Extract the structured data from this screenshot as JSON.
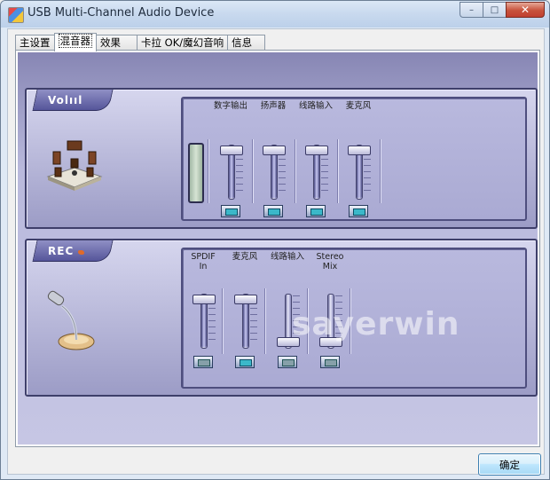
{
  "window": {
    "title": "USB Multi-Channel Audio Device",
    "min_glyph": "–",
    "max_glyph": "□",
    "close_glyph": "✕"
  },
  "tabs": [
    {
      "label": "主设置",
      "active": false
    },
    {
      "label": "混音器",
      "active": true
    },
    {
      "label": "效果",
      "active": false
    },
    {
      "label": "卡拉 OK/魔幻音响",
      "active": false
    },
    {
      "label": "信息",
      "active": false
    }
  ],
  "volume_section": {
    "badge": "Volııl",
    "channels": [
      {
        "label": "数字输出",
        "level": 0.95,
        "button_state": "on"
      },
      {
        "label": "扬声器",
        "level": 0.95,
        "button_state": "on"
      },
      {
        "label": "线路输入",
        "level": 0.95,
        "button_state": "on"
      },
      {
        "label": "麦克风",
        "level": 0.95,
        "button_state": "on"
      }
    ]
  },
  "record_section": {
    "badge": "REC",
    "channels": [
      {
        "label": "SPDIF",
        "sublabel": "In",
        "level": 0.95,
        "button_state": "off"
      },
      {
        "label": "麦克风",
        "sublabel": "",
        "level": 0.95,
        "button_state": "on"
      },
      {
        "label": "线路输入",
        "sublabel": "",
        "level": 0.05,
        "button_state": "off"
      },
      {
        "label": "Stereo",
        "sublabel": "Mix",
        "level": 0.05,
        "button_state": "off"
      }
    ]
  },
  "watermark": "sayerwin",
  "ok_button": "确定",
  "colors": {
    "panel_accent": "#55559a",
    "button_on": "#3bb8c9",
    "close_button": "#c8523b"
  }
}
